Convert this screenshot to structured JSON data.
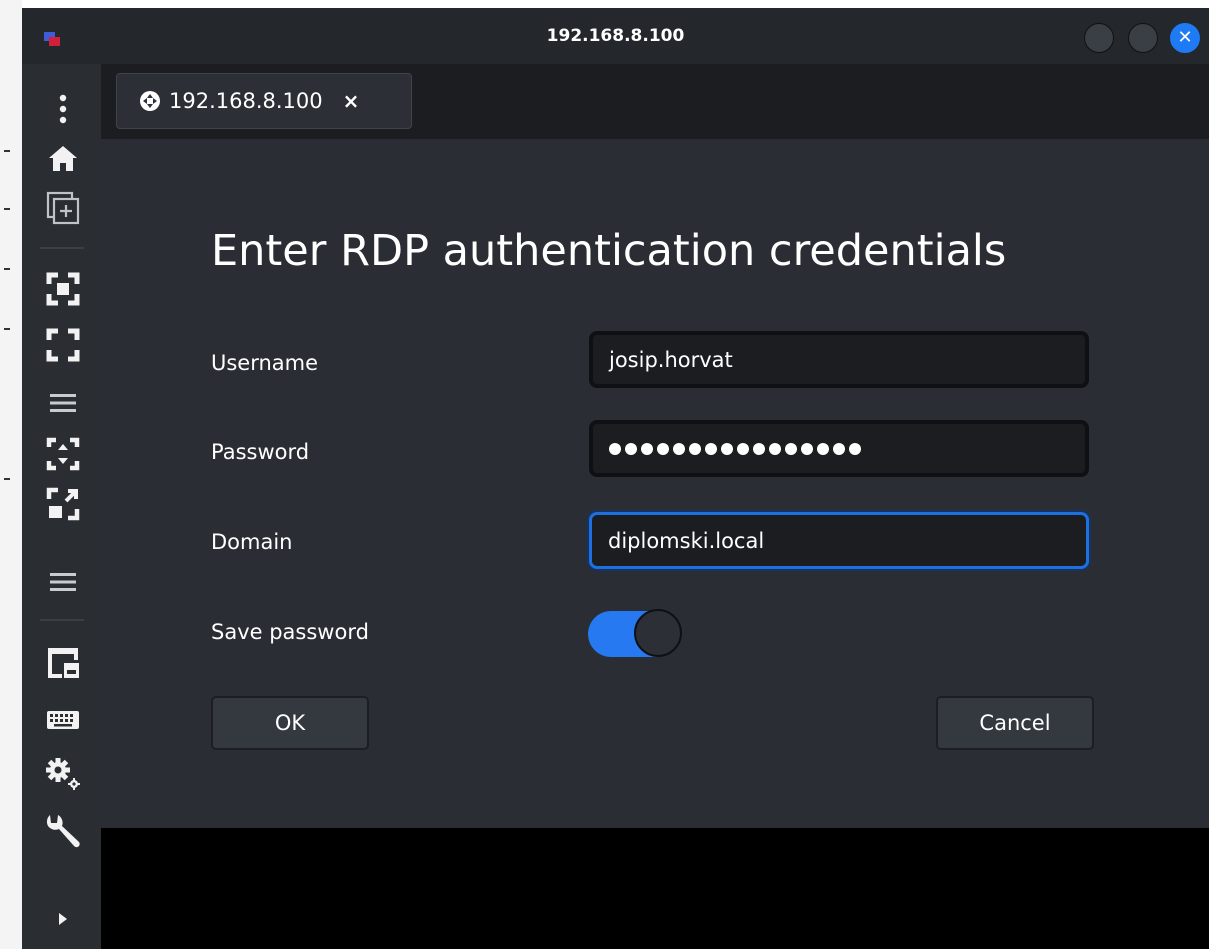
{
  "window": {
    "title": "192.168.8.100",
    "close_glyph": "✕"
  },
  "tab": {
    "label": "192.168.8.100",
    "icon": "remote-connection-icon",
    "close_glyph": "×"
  },
  "sidebar": {
    "items": [
      {
        "icon": "menu-dots-icon"
      },
      {
        "icon": "home-icon"
      },
      {
        "icon": "new-tab-icon"
      },
      {
        "icon": "fullscreen-icon"
      },
      {
        "icon": "scaled-mode-icon"
      },
      {
        "icon": "menu-lines-icon"
      },
      {
        "icon": "autofit-icon"
      },
      {
        "icon": "dynamic-resolution-icon"
      },
      {
        "icon": "menu-lines-icon"
      },
      {
        "icon": "window-icon"
      },
      {
        "icon": "keyboard-icon"
      },
      {
        "icon": "settings-icon"
      },
      {
        "icon": "tools-icon"
      },
      {
        "icon": "expand-arrow-icon"
      }
    ]
  },
  "dialog": {
    "title": "Enter RDP authentication credentials",
    "username_label": "Username",
    "username_value": "josip.horvat",
    "password_label": "Password",
    "password_length": 16,
    "domain_label": "Domain",
    "domain_value": "diplomski.local",
    "save_password_label": "Save password",
    "save_password_on": true,
    "ok_label": "OK",
    "cancel_label": "Cancel"
  },
  "colors": {
    "accent": "#2679f0",
    "background": "#2a2d33",
    "sidebar": "#2a2d32",
    "titlebar": "#24272c"
  }
}
